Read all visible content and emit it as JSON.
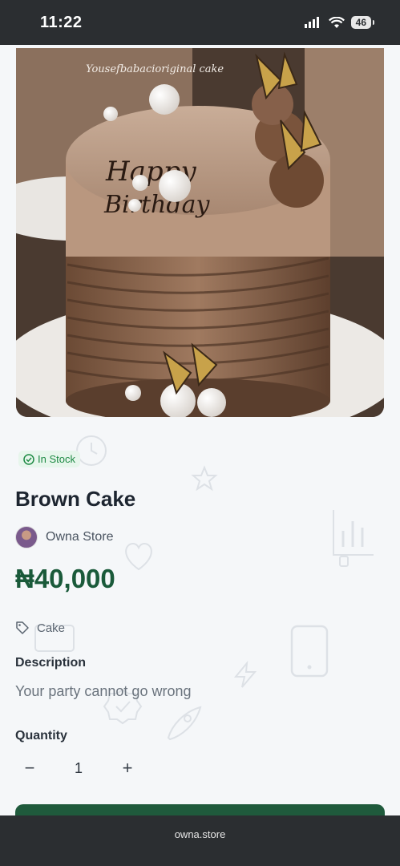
{
  "status_bar": {
    "time": "11:22",
    "battery": "46",
    "icons": [
      "signal-icon",
      "wifi-icon",
      "battery-icon"
    ]
  },
  "product": {
    "image_caption": "Yousefbabacioriginal cake",
    "cake_topper_text": [
      "Happy",
      "Birthday"
    ],
    "stock_status": "In Stock",
    "title": "Brown Cake",
    "store_name": "Owna Store",
    "price": "₦40,000",
    "category_tag": "Cake",
    "description_label": "Description",
    "description": "Your party cannot go wrong",
    "quantity_label": "Quantity",
    "quantity_value": "1",
    "decrement_symbol": "−",
    "increment_symbol": "+"
  },
  "browser": {
    "url": "owna.store"
  },
  "colors": {
    "price_green": "#1a5a3a",
    "stock_green": "#1e8a44",
    "cta_green": "#1f5a3c",
    "bar_dark": "#2b2e31"
  }
}
